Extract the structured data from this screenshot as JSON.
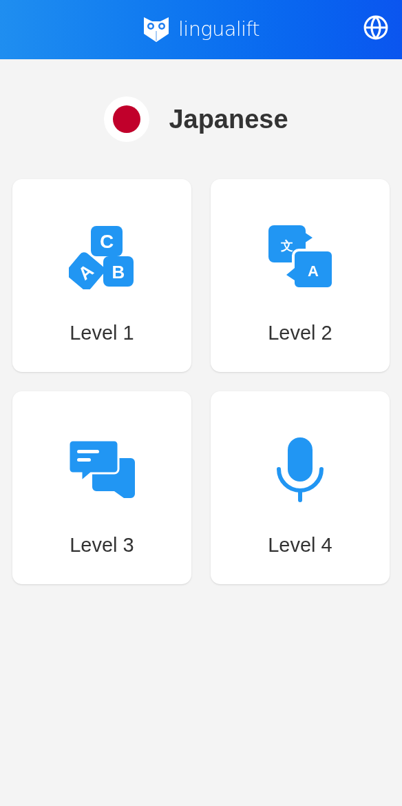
{
  "header": {
    "logo_text": "lingualift"
  },
  "language": {
    "name": "Japanese"
  },
  "levels": [
    {
      "label": "Level 1",
      "kind": "blocks",
      "glyphs": [
        "C",
        "A",
        "B"
      ]
    },
    {
      "label": "Level 2",
      "kind": "translate",
      "glyphs": [
        "文",
        "A"
      ]
    },
    {
      "label": "Level 3",
      "kind": "chat"
    },
    {
      "label": "Level 4",
      "kind": "mic"
    }
  ]
}
